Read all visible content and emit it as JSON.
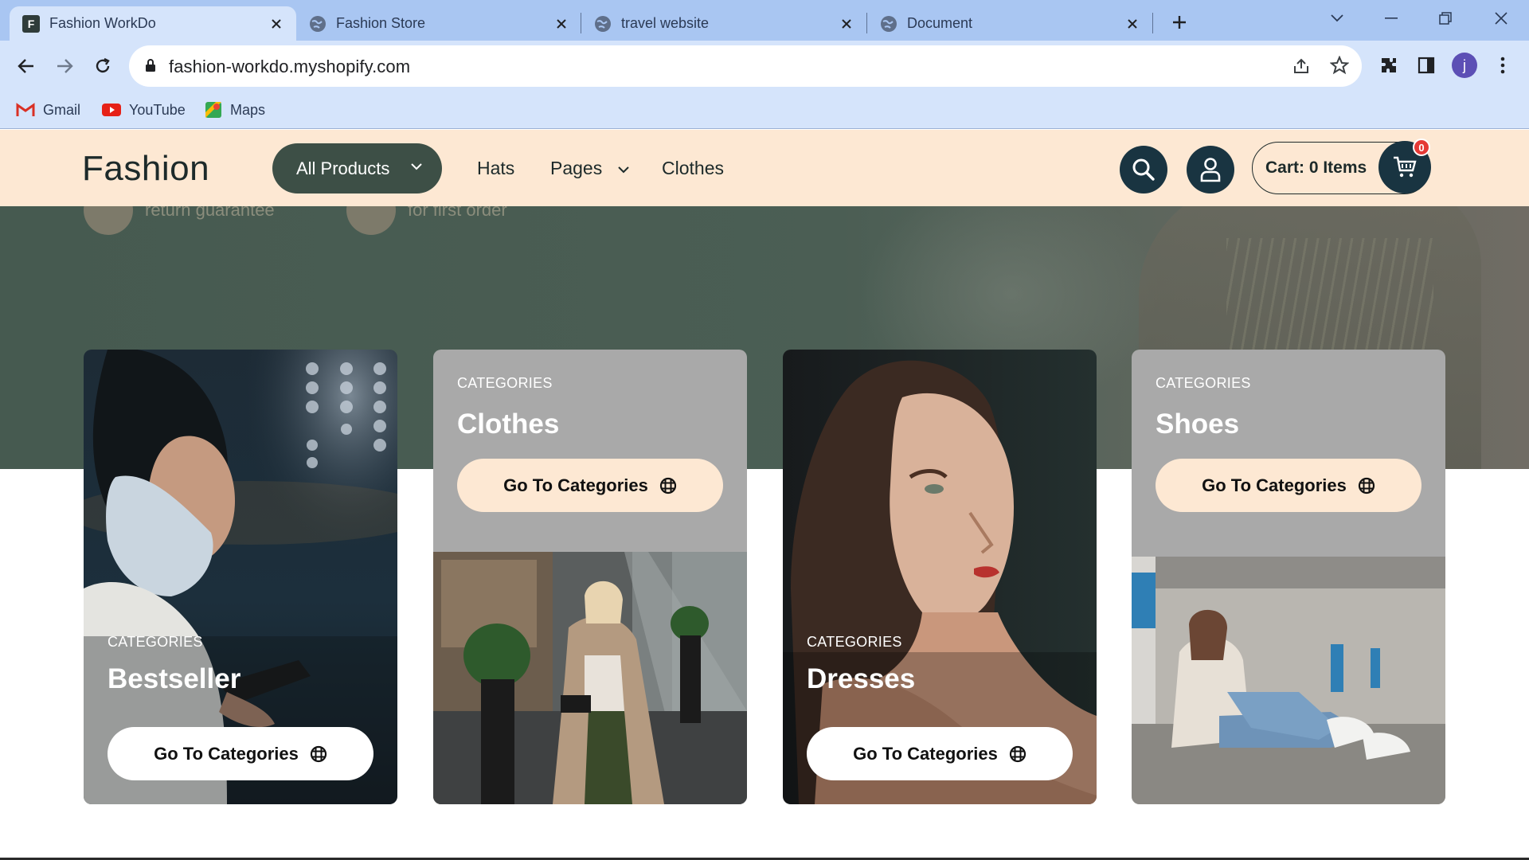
{
  "browser": {
    "tabs": [
      {
        "title": "Fashion WorkDo",
        "favicon": "F",
        "active": true
      },
      {
        "title": "Fashion Store",
        "active": false
      },
      {
        "title": "travel website",
        "active": false
      },
      {
        "title": "Document",
        "active": false
      }
    ],
    "address": "fashion-workdo.myshopify.com",
    "bookmarks": [
      {
        "label": "Gmail"
      },
      {
        "label": "YouTube"
      },
      {
        "label": "Maps"
      }
    ],
    "profile_initial": "j"
  },
  "header": {
    "logo": "Fashion",
    "all_products": "All Products",
    "menu": [
      "Hats",
      "Pages",
      "Clothes"
    ],
    "cart_label": "Cart: 0 Items",
    "cart_count": "0"
  },
  "hero": {
    "features": [
      "return guarantee",
      "for first order"
    ]
  },
  "categories": [
    {
      "label": "CATEGORIES",
      "title": "Bestseller",
      "button": "Go To Categories"
    },
    {
      "label": "CATEGORIES",
      "title": "Clothes",
      "button": "Go To Categories"
    },
    {
      "label": "CATEGORIES",
      "title": "Dresses",
      "button": "Go To Categories"
    },
    {
      "label": "CATEGORIES",
      "title": "Shoes",
      "button": "Go To Categories"
    }
  ],
  "colors": {
    "header_bg": "#fde8d3",
    "brand_dark": "#193441",
    "pill_green": "#3d4f46",
    "hero_green": "#4b5e54",
    "card_grey": "#a9a9a9",
    "badge_red": "#e53935"
  }
}
